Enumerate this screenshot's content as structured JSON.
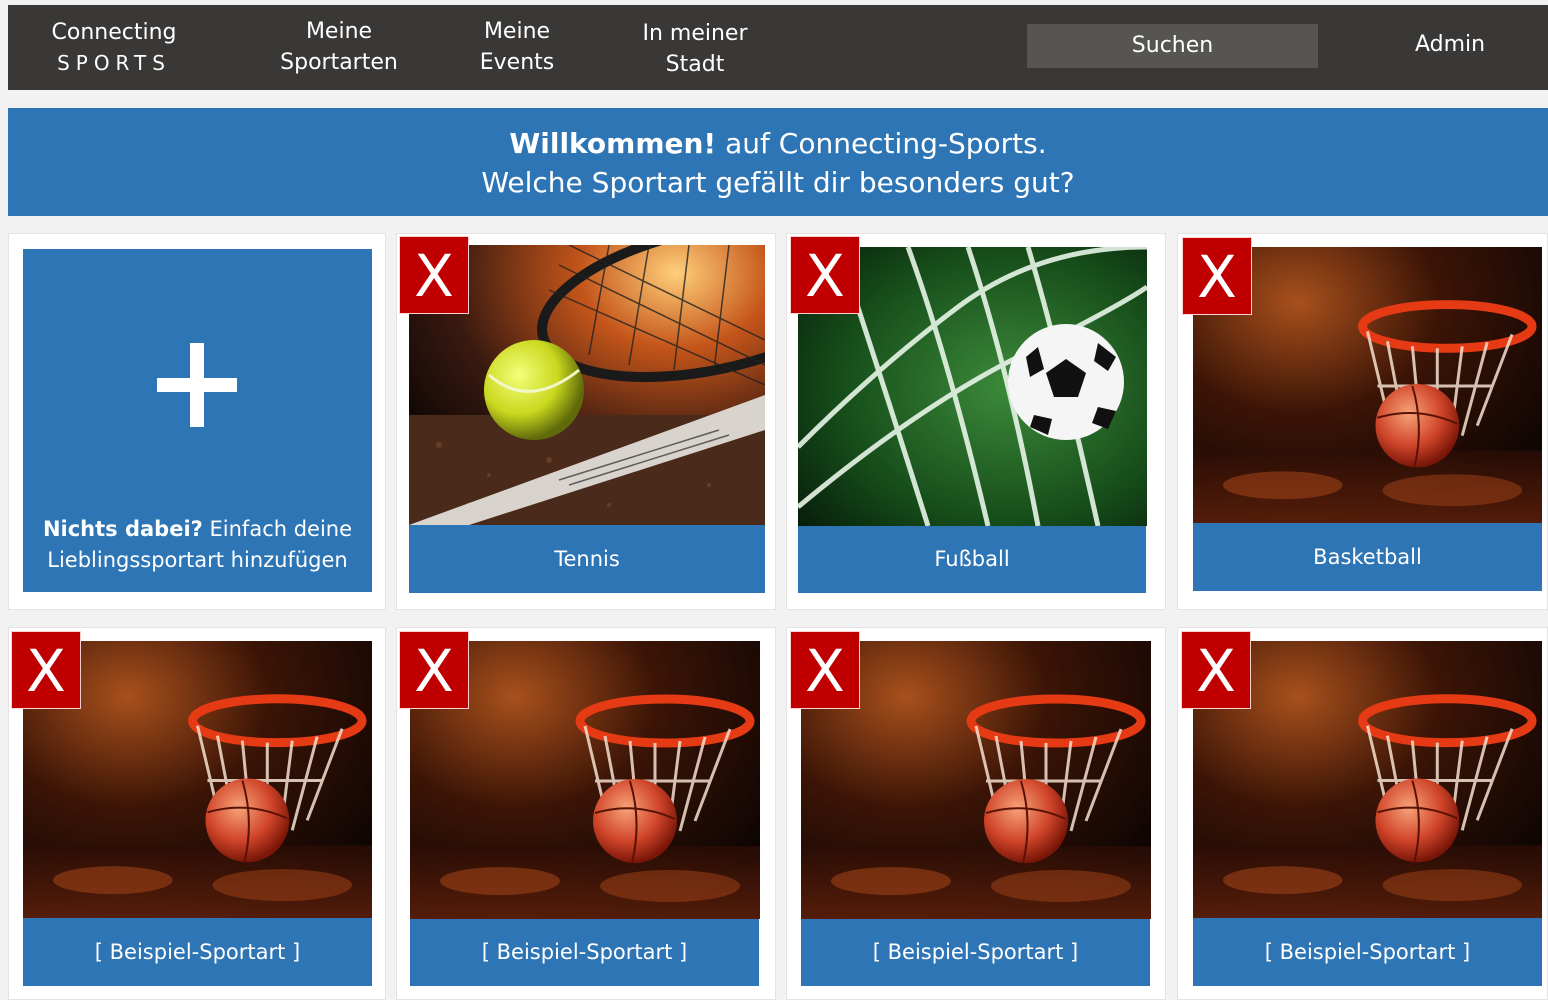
{
  "nav": {
    "brand_line1": "Connecting",
    "brand_line2": "SPORTS",
    "sport_line1": "Meine",
    "sport_line2": "Sportarten",
    "events_line1": "Meine",
    "events_line2": "Events",
    "city_line1": "In meiner",
    "city_line2": "Stadt",
    "search_label": "Suchen",
    "admin_label": "Admin"
  },
  "banner": {
    "bold": "Willkommen!",
    "line1_rest": " auf Connecting-Sports.",
    "line2": "Welche Sportart gefällt dir besonders gut?"
  },
  "add_tile": {
    "bold": "Nichts dabei?",
    "rest": " Einfach deine",
    "line2": "Lieblingssportart hinzufügen"
  },
  "remove_label": "X",
  "sports": [
    {
      "label": "Tennis",
      "icon": "tennis-image"
    },
    {
      "label": "Fußball",
      "icon": "football-image"
    },
    {
      "label": "Basketball",
      "icon": "basketball-image"
    },
    {
      "label": "[ Beispiel-Sportart ]",
      "icon": "basketball-image"
    },
    {
      "label": "[ Beispiel-Sportart ]",
      "icon": "basketball-image"
    },
    {
      "label": "[ Beispiel-Sportart ]",
      "icon": "basketball-image"
    },
    {
      "label": "[ Beispiel-Sportart ]",
      "icon": "basketball-image"
    }
  ],
  "colors": {
    "nav_bg": "#3a3836",
    "accent_blue": "#2e75b6",
    "remove_red": "#c00000"
  }
}
